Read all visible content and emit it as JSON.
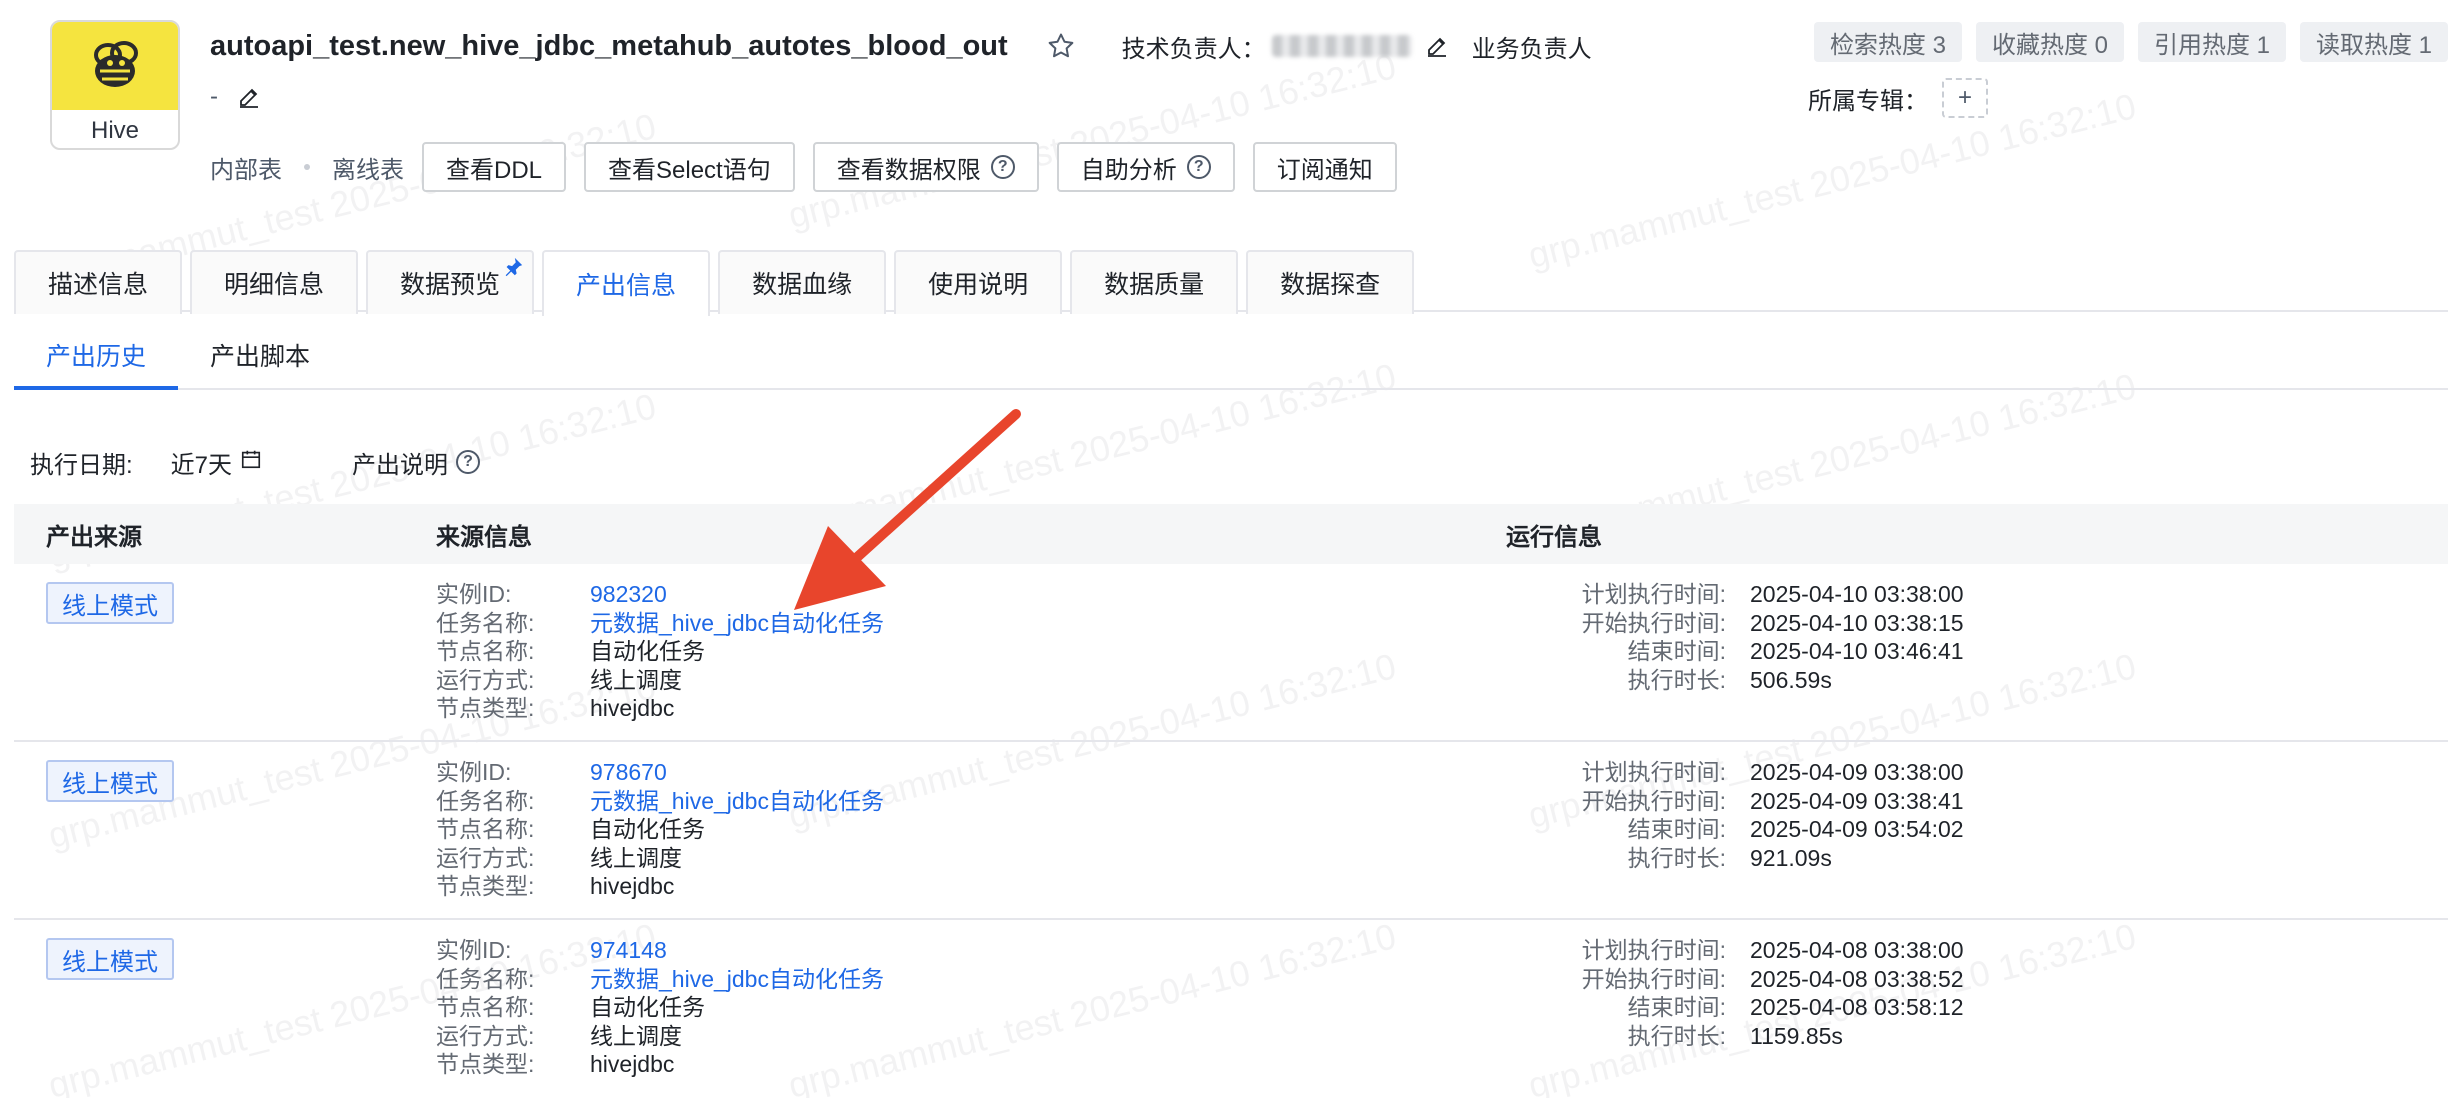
{
  "header": {
    "logo_label": "Hive",
    "title": "autoapi_test.new_hive_jdbc_metahub_autotes_blood_out",
    "tech_owner_label": "技术负责人：",
    "biz_owner_label": "业务负责人",
    "description": "-",
    "heat": [
      {
        "label": "检索热度 3"
      },
      {
        "label": "收藏热度 0"
      },
      {
        "label": "引用热度 1"
      },
      {
        "label": "读取热度 1"
      }
    ],
    "topic_label": "所属专辑：",
    "topic_add": "+",
    "meta_tags": [
      "内部表",
      "离线表"
    ],
    "buttons": {
      "ddl": "查看DDL",
      "select": "查看Select语句",
      "permission": "查看数据权限",
      "analysis": "自助分析",
      "subscribe": "订阅通知"
    }
  },
  "tabs": [
    {
      "label": "描述信息"
    },
    {
      "label": "明细信息"
    },
    {
      "label": "数据预览"
    },
    {
      "label": "产出信息"
    },
    {
      "label": "数据血缘"
    },
    {
      "label": "使用说明"
    },
    {
      "label": "数据质量"
    },
    {
      "label": "数据探查"
    }
  ],
  "subtabs": [
    {
      "label": "产出历史"
    },
    {
      "label": "产出脚本"
    }
  ],
  "filter": {
    "date_label": "执行日期:",
    "date_value": "近7天",
    "note_label": "产出说明"
  },
  "table": {
    "headers": {
      "source": "产出来源",
      "info": "来源信息",
      "run": "运行信息"
    },
    "info_labels": [
      "实例ID:",
      "任务名称:",
      "节点名称:",
      "运行方式:",
      "节点类型:"
    ],
    "run_labels": [
      "计划执行时间:",
      "开始执行时间:",
      "结束时间:",
      "执行时长:"
    ],
    "rows": [
      {
        "mode": "线上模式",
        "instance_id": "982320",
        "task_name": "元数据_hive_jdbc自动化任务",
        "node_name": "自动化任务",
        "run_mode": "线上调度",
        "node_type": "hivejdbc",
        "plan_time": "2025-04-10 03:38:00",
        "start_time": "2025-04-10 03:38:15",
        "end_time": "2025-04-10 03:46:41",
        "duration": "506.59s"
      },
      {
        "mode": "线上模式",
        "instance_id": "978670",
        "task_name": "元数据_hive_jdbc自动化任务",
        "node_name": "自动化任务",
        "run_mode": "线上调度",
        "node_type": "hivejdbc",
        "plan_time": "2025-04-09 03:38:00",
        "start_time": "2025-04-09 03:38:41",
        "end_time": "2025-04-09 03:54:02",
        "duration": "921.09s"
      },
      {
        "mode": "线上模式",
        "instance_id": "974148",
        "task_name": "元数据_hive_jdbc自动化任务",
        "node_name": "自动化任务",
        "run_mode": "线上调度",
        "node_type": "hivejdbc",
        "plan_time": "2025-04-08 03:38:00",
        "start_time": "2025-04-08 03:38:52",
        "end_time": "2025-04-08 03:58:12",
        "duration": "1159.85s"
      }
    ]
  },
  "watermark": "grp.mammut_test 2025-04-10 16:32:10",
  "colors": {
    "accent": "#1e68e6",
    "arrow": "#e8452c",
    "logo_bg": "#f5e43f"
  }
}
